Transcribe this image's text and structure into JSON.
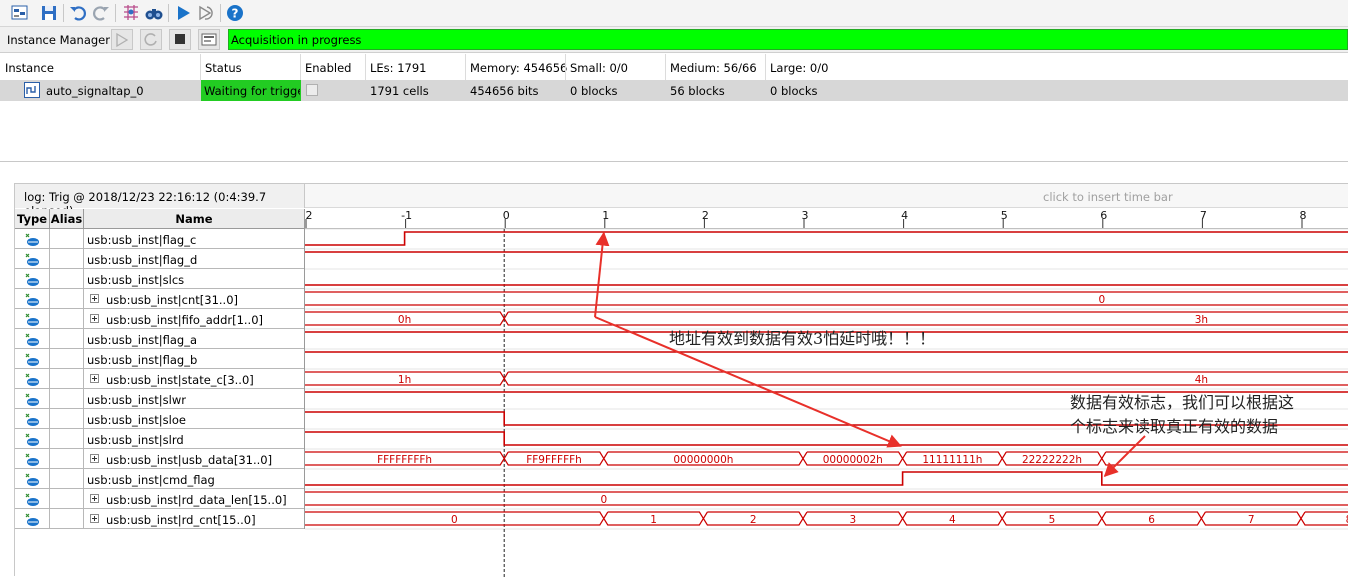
{
  "toolbar": {
    "icons": [
      "setup-icon",
      "save-icon",
      "undo-icon",
      "redo-icon",
      "node-finder-icon",
      "find-icon",
      "run-icon",
      "autorun-icon",
      "help-icon"
    ]
  },
  "instance_manager": {
    "label": "Instance Manager:",
    "status_message": "Acquisition in progress",
    "status_color": "#00ff00"
  },
  "instances": {
    "headers": {
      "instance": "Instance",
      "status": "Status",
      "enabled": "Enabled",
      "les": "LEs: 1791",
      "memory": "Memory: 454656",
      "small": "Small: 0/0",
      "medium": "Medium: 56/66",
      "large": "Large: 0/0"
    },
    "rows": [
      {
        "name": "auto_signaltap_0",
        "status": "Waiting for trigger",
        "les": "1791 cells",
        "memory": "454656 bits",
        "small": "0 blocks",
        "medium": "56 blocks",
        "large": "0 blocks"
      }
    ]
  },
  "log": {
    "title": "log: Trig @ 2018/12/23 22:16:12 (0:4:39.7 elapsed)",
    "timebar_hint": "click to insert time bar",
    "columns": {
      "type": "Type",
      "alias": "Alias",
      "name": "Name"
    },
    "ruler_ticks": [
      "-2",
      "-1",
      "0",
      "1",
      "2",
      "3",
      "4",
      "5",
      "6",
      "7",
      "8"
    ],
    "signal_color": "#cc0000",
    "signals": [
      {
        "name": "usb:usb_inst|flag_c",
        "bus": false,
        "wave": {
          "kind": "bit",
          "edges": [
            [
              -2,
              0
            ],
            [
              -1,
              1
            ]
          ]
        }
      },
      {
        "name": "usb:usb_inst|flag_d",
        "bus": false,
        "wave": {
          "kind": "bit",
          "edges": [
            [
              -2,
              1
            ]
          ]
        }
      },
      {
        "name": "usb:usb_inst|slcs",
        "bus": false,
        "wave": {
          "kind": "bit",
          "edges": [
            [
              -2,
              0
            ]
          ]
        }
      },
      {
        "name": "usb:usb_inst|cnt[31..0]",
        "bus": true,
        "wave": {
          "kind": "bus",
          "segments": [
            [
              -2,
              8.5,
              "0",
              6
            ]
          ]
        }
      },
      {
        "name": "usb:usb_inst|fifo_addr[1..0]",
        "bus": true,
        "wave": {
          "kind": "bus",
          "segments": [
            [
              -2,
              0,
              "0h",
              -1
            ],
            [
              0,
              8.5,
              "3h",
              7
            ]
          ]
        }
      },
      {
        "name": "usb:usb_inst|flag_a",
        "bus": false,
        "wave": {
          "kind": "bit",
          "edges": [
            [
              -2,
              1
            ]
          ]
        }
      },
      {
        "name": "usb:usb_inst|flag_b",
        "bus": false,
        "wave": {
          "kind": "bit",
          "edges": [
            [
              -2,
              1
            ]
          ]
        }
      },
      {
        "name": "usb:usb_inst|state_c[3..0]",
        "bus": true,
        "wave": {
          "kind": "bus",
          "segments": [
            [
              -2,
              0,
              "1h",
              -1
            ],
            [
              0,
              8.5,
              "4h",
              7
            ]
          ]
        }
      },
      {
        "name": "usb:usb_inst|slwr",
        "bus": false,
        "wave": {
          "kind": "bit",
          "edges": [
            [
              -2,
              1
            ]
          ]
        }
      },
      {
        "name": "usb:usb_inst|sloe",
        "bus": false,
        "wave": {
          "kind": "bit",
          "edges": [
            [
              -2,
              1
            ],
            [
              0,
              0
            ]
          ]
        }
      },
      {
        "name": "usb:usb_inst|slrd",
        "bus": false,
        "wave": {
          "kind": "bit",
          "edges": [
            [
              -2,
              1
            ],
            [
              0,
              0
            ]
          ]
        }
      },
      {
        "name": "usb:usb_inst|usb_data[31..0]",
        "bus": true,
        "wave": {
          "kind": "bus",
          "segments": [
            [
              -2,
              0,
              "FFFFFFFFh",
              -1
            ],
            [
              0,
              1,
              "FF9FFFFFh",
              0.5
            ],
            [
              1,
              3,
              "00000000h",
              2
            ],
            [
              3,
              4,
              "00000002h",
              3.5
            ],
            [
              4,
              5,
              "11111111h",
              4.5
            ],
            [
              5,
              6,
              "22222222h",
              5.5
            ],
            [
              6,
              8.5,
              "",
              7
            ]
          ]
        }
      },
      {
        "name": "usb:usb_inst|cmd_flag",
        "bus": false,
        "wave": {
          "kind": "bit",
          "edges": [
            [
              -2,
              0
            ],
            [
              4,
              1
            ],
            [
              6,
              0
            ]
          ]
        }
      },
      {
        "name": "usb:usb_inst|rd_data_len[15..0]",
        "bus": true,
        "wave": {
          "kind": "bus",
          "segments": [
            [
              -2,
              8.5,
              "0",
              1
            ]
          ]
        }
      },
      {
        "name": "usb:usb_inst|rd_cnt[15..0]",
        "bus": true,
        "wave": {
          "kind": "bus",
          "segments": [
            [
              -2,
              1,
              "0",
              -0.5
            ],
            [
              1,
              2,
              "1",
              1.5
            ],
            [
              2,
              3,
              "2",
              2.5
            ],
            [
              3,
              4,
              "3",
              3.5
            ],
            [
              4,
              5,
              "4",
              4.5
            ],
            [
              5,
              6,
              "5",
              5.5
            ],
            [
              6,
              7,
              "6",
              6.5
            ],
            [
              7,
              8,
              "7",
              7.5
            ],
            [
              8,
              8.5,
              "8",
              8.5
            ]
          ]
        }
      }
    ]
  },
  "annotations": {
    "latency_note": "地址有效到数据有效3怕延时哦！！！",
    "flag_note_line1": "数据有效标志，我们可以根据这",
    "flag_note_line2": "个标志来读取真正有效的数据",
    "arrow_color": "#e8302a"
  }
}
